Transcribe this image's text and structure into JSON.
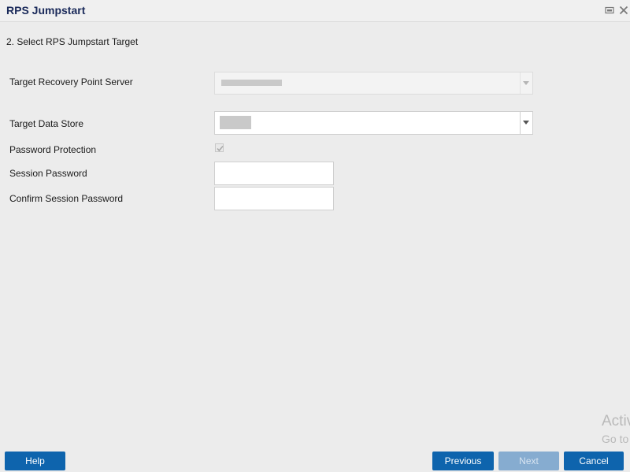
{
  "window": {
    "title": "RPS Jumpstart",
    "controls": [
      "restore-icon",
      "close-icon"
    ]
  },
  "wizard": {
    "step_heading": "2. Select RPS Jumpstart Target"
  },
  "form": {
    "target_rps_label": "Target Recovery Point Server",
    "target_rps_value": "",
    "target_rps_disabled": true,
    "target_datastore_label": "Target Data Store",
    "target_datastore_value": "",
    "password_protection_label": "Password Protection",
    "password_protection_checked": true,
    "password_protection_disabled": true,
    "session_password_label": "Session Password",
    "session_password_value": "",
    "confirm_password_label": "Confirm Session Password",
    "confirm_password_value": ""
  },
  "footer": {
    "help_label": "Help",
    "previous_label": "Previous",
    "next_label": "Next",
    "next_disabled": true,
    "cancel_label": "Cancel"
  },
  "watermark": {
    "line1": "Activ",
    "line2": "Go to"
  },
  "colors": {
    "accent": "#0e64ad",
    "accent_disabled": "#86acd0",
    "title": "#1a2a5a",
    "background": "#ececec"
  }
}
